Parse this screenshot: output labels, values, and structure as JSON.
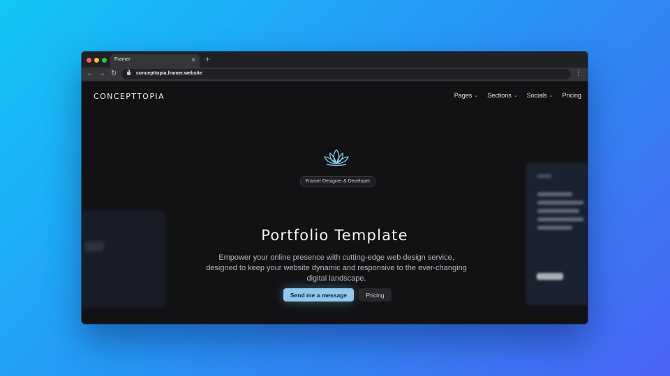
{
  "browser": {
    "tab_title": "Framer",
    "url": "concepttopia.framer.website",
    "icons": {
      "close": "close-icon",
      "new_tab": "plus-icon",
      "back": "arrow-left-icon",
      "forward": "arrow-right-icon",
      "reload": "reload-icon",
      "lock": "lock-icon",
      "menu": "kebab-menu-icon"
    }
  },
  "site": {
    "logo": "CONCEPTTOPIA",
    "nav": [
      {
        "label": "Pages",
        "has_dropdown": true
      },
      {
        "label": "Sections",
        "has_dropdown": true
      },
      {
        "label": "Socials",
        "has_dropdown": true
      },
      {
        "label": "Pricing",
        "has_dropdown": false
      }
    ]
  },
  "hero": {
    "icon": "lotus-icon",
    "badge": "Framer Designer & Developer",
    "title": "Portfolio Template",
    "subtitle": "Empower your online presence with cutting-edge web design service, designed to keep your website dynamic and responsive to the ever-changing digital landscape.",
    "primary_button": "Send me a message",
    "secondary_button": "Pricing"
  },
  "colors": {
    "background_start": "#12c6f8",
    "background_end": "#4a63f5",
    "page_bg": "#121214",
    "primary_button": "#92c8ef",
    "lotus_stroke": "#8ecbf3"
  }
}
